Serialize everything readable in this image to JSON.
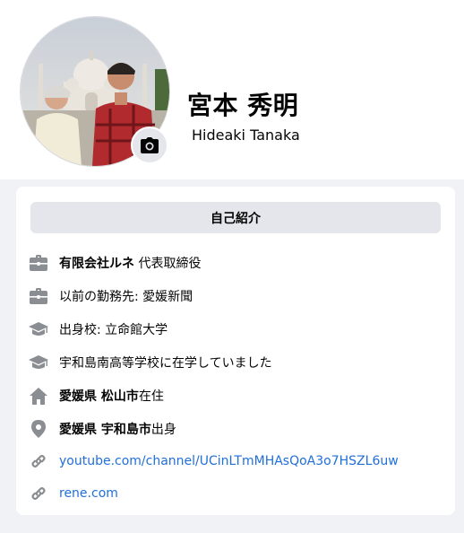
{
  "profile": {
    "name": "宮本 秀明",
    "alt_name": "Hideaki Tanaka"
  },
  "intro": {
    "title": "自己紹介",
    "items": [
      {
        "icon": "briefcase-icon",
        "bold": "有限会社ルネ",
        "text": " 代表取締役"
      },
      {
        "icon": "briefcase-icon",
        "text": "以前の勤務先: 愛媛新聞"
      },
      {
        "icon": "graduation-cap-icon",
        "text": "出身校: 立命館大学"
      },
      {
        "icon": "graduation-cap-icon",
        "text": "宇和島南高等学校に在学していました"
      },
      {
        "icon": "home-icon",
        "bold": "愛媛県 松山市",
        "text": "在住"
      },
      {
        "icon": "location-pin-icon",
        "bold": "愛媛県 宇和島市",
        "text": "出身"
      },
      {
        "icon": "link-icon",
        "link": "youtube.com/channel/UCinLTmMHAsQoA3o7HSZL6uw"
      },
      {
        "icon": "link-icon",
        "link": "rene.com"
      }
    ]
  },
  "colors": {
    "link": "#216fdb",
    "icon": "#8a8d91",
    "section_bg": "#f0f2f5",
    "intro_header_bg": "#e4e6eb"
  }
}
